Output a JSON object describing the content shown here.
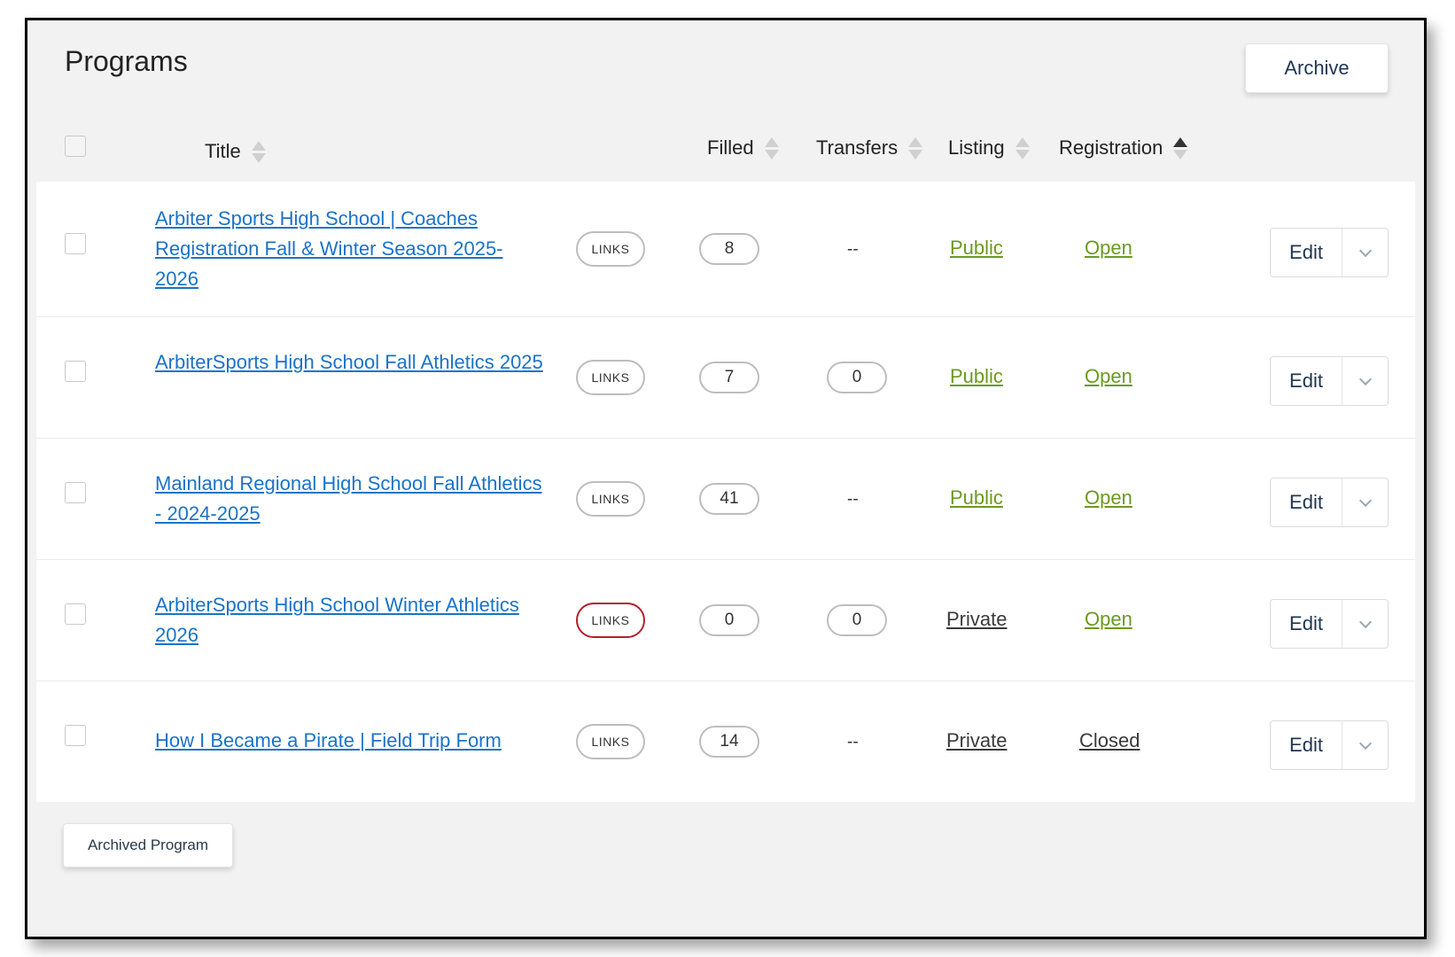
{
  "page": {
    "title": "Programs",
    "archive_label": "Archive",
    "archived_program_label": "Archived Program"
  },
  "columns": {
    "title": "Title",
    "filled": "Filled",
    "transfers": "Transfers",
    "listing": "Listing",
    "registration": "Registration"
  },
  "sort": {
    "active_column": "registration",
    "direction": "ascending"
  },
  "colors": {
    "link": "#1a73c9",
    "status_green": "#6b9a1f",
    "links_highlight": "#b3202a"
  },
  "rows": [
    {
      "title": "Arbiter Sports High School | Coaches Registration Fall & Winter Season 2025-2026",
      "links": "LINKS",
      "filled": "8",
      "transfers": "--",
      "listing": "Public",
      "registration": "Open",
      "edit": "Edit"
    },
    {
      "title": "ArbiterSports High School Fall Athletics 2025",
      "links": "LINKS",
      "filled": "7",
      "transfers": "0",
      "listing": "Public",
      "registration": "Open",
      "edit": "Edit"
    },
    {
      "title": "Mainland Regional High School Fall Athletics - 2024-2025",
      "links": "LINKS",
      "filled": "41",
      "transfers": "--",
      "listing": "Public",
      "registration": "Open",
      "edit": "Edit"
    },
    {
      "title": "ArbiterSports High School Winter Athletics 2026",
      "links": "LINKS",
      "filled": "0",
      "transfers": "0",
      "listing": "Private",
      "registration": "Open",
      "edit": "Edit"
    },
    {
      "title": "How I Became a Pirate | Field Trip Form",
      "links": "LINKS",
      "filled": "14",
      "transfers": "--",
      "listing": "Private",
      "registration": "Closed",
      "edit": "Edit"
    }
  ]
}
